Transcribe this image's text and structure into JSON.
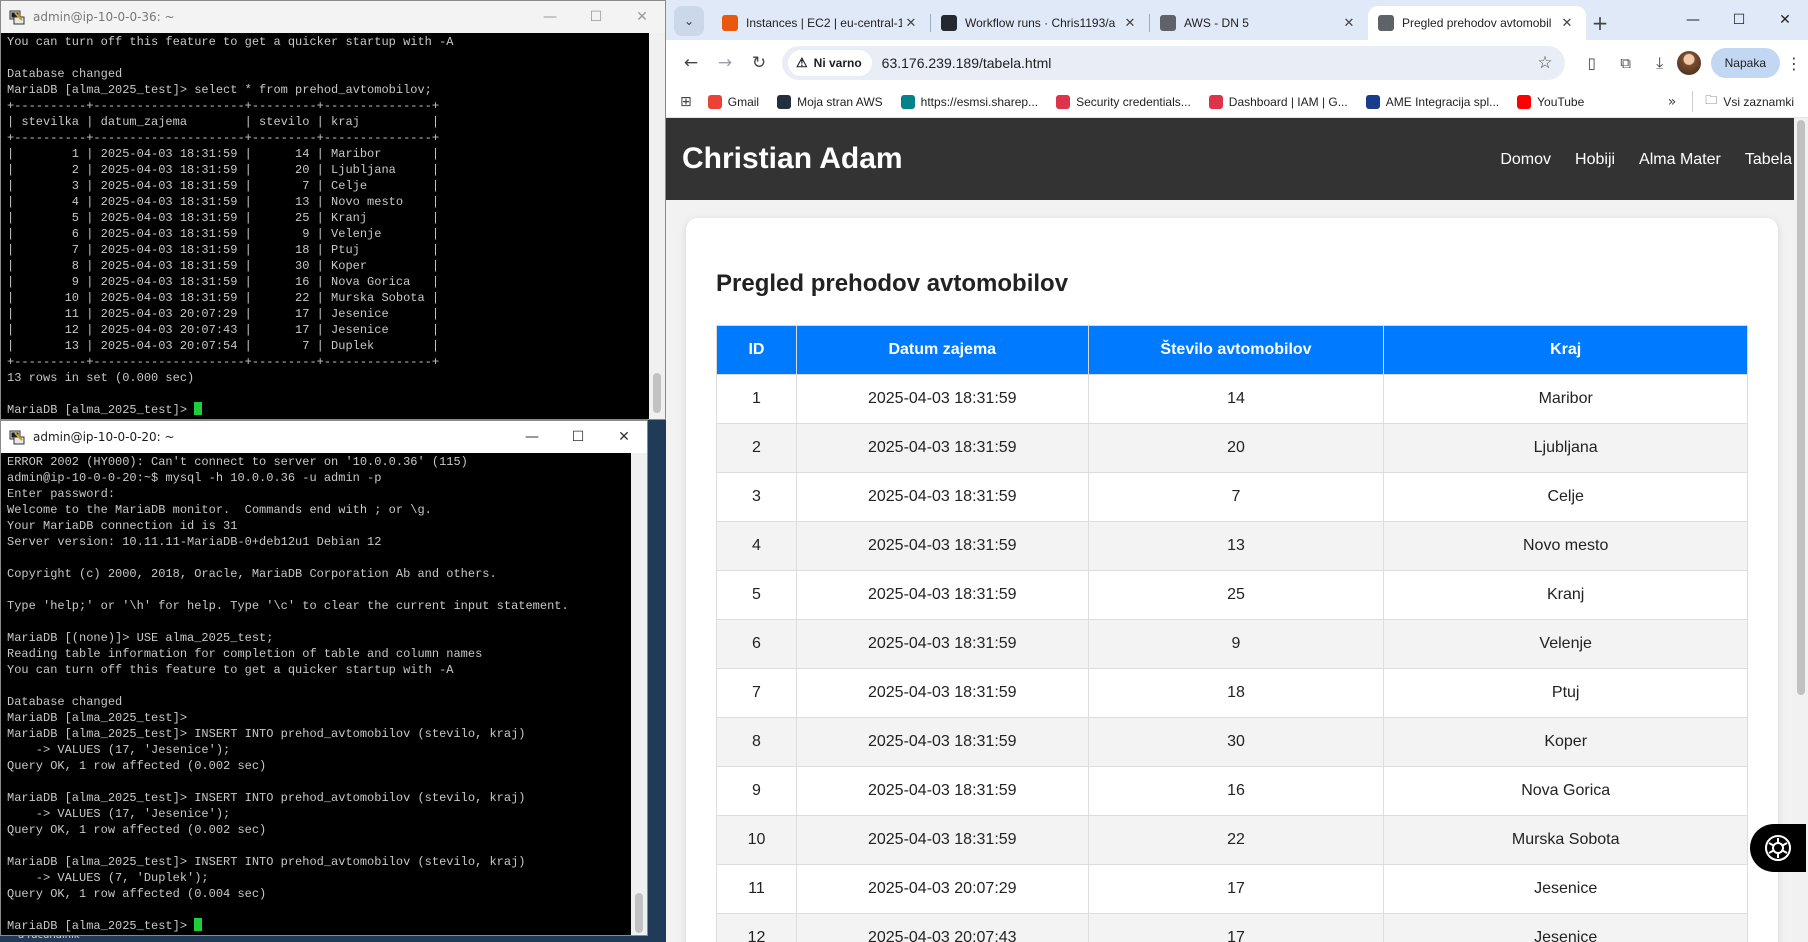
{
  "desktop": {
    "bottom_label": "a računalnik"
  },
  "putty_top": {
    "title": "admin@ip-10-0-0-36: ~",
    "lines": [
      "You can turn off this feature to get a quicker startup with -A",
      "",
      "Database changed",
      "MariaDB [alma_2025_test]> select * from prehod_avtomobilov;",
      "+----------+---------------------+---------+---------------+",
      "| stevilka | datum_zajema        | stevilo | kraj          |",
      "+----------+---------------------+---------+---------------+",
      "|        1 | 2025-04-03 18:31:59 |      14 | Maribor       |",
      "|        2 | 2025-04-03 18:31:59 |      20 | Ljubljana     |",
      "|        3 | 2025-04-03 18:31:59 |       7 | Celje         |",
      "|        4 | 2025-04-03 18:31:59 |      13 | Novo mesto    |",
      "|        5 | 2025-04-03 18:31:59 |      25 | Kranj         |",
      "|        6 | 2025-04-03 18:31:59 |       9 | Velenje       |",
      "|        7 | 2025-04-03 18:31:59 |      18 | Ptuj          |",
      "|        8 | 2025-04-03 18:31:59 |      30 | Koper         |",
      "|        9 | 2025-04-03 18:31:59 |      16 | Nova Gorica   |",
      "|       10 | 2025-04-03 18:31:59 |      22 | Murska Sobota |",
      "|       11 | 2025-04-03 20:07:29 |      17 | Jesenice      |",
      "|       12 | 2025-04-03 20:07:43 |      17 | Jesenice      |",
      "|       13 | 2025-04-03 20:07:54 |       7 | Duplek        |",
      "+----------+---------------------+---------+---------------+",
      "13 rows in set (0.000 sec)",
      ""
    ],
    "prompt": "MariaDB [alma_2025_test]> "
  },
  "putty_bottom": {
    "title": "admin@ip-10-0-0-20: ~",
    "lines": [
      "ERROR 2002 (HY000): Can't connect to server on '10.0.0.36' (115)",
      "admin@ip-10-0-0-20:~$ mysql -h 10.0.0.36 -u admin -p",
      "Enter password:",
      "Welcome to the MariaDB monitor.  Commands end with ; or \\g.",
      "Your MariaDB connection id is 31",
      "Server version: 10.11.11-MariaDB-0+deb12u1 Debian 12",
      "",
      "Copyright (c) 2000, 2018, Oracle, MariaDB Corporation Ab and others.",
      "",
      "Type 'help;' or '\\h' for help. Type '\\c' to clear the current input statement.",
      "",
      "MariaDB [(none)]> USE alma_2025_test;",
      "Reading table information for completion of table and column names",
      "You can turn off this feature to get a quicker startup with -A",
      "",
      "Database changed",
      "MariaDB [alma_2025_test]>",
      "MariaDB [alma_2025_test]> INSERT INTO prehod_avtomobilov (stevilo, kraj)",
      "    -> VALUES (17, 'Jesenice');",
      "Query OK, 1 row affected (0.002 sec)",
      "",
      "MariaDB [alma_2025_test]> INSERT INTO prehod_avtomobilov (stevilo, kraj)",
      "    -> VALUES (17, 'Jesenice');",
      "Query OK, 1 row affected (0.002 sec)",
      "",
      "MariaDB [alma_2025_test]> INSERT INTO prehod_avtomobilov (stevilo, kraj)",
      "    -> VALUES (7, 'Duplek');",
      "Query OK, 1 row affected (0.004 sec)",
      ""
    ],
    "prompt": "MariaDB [alma_2025_test]> "
  },
  "browser": {
    "tabs": [
      {
        "label": "Instances | EC2 | eu-central-1",
        "icon": "aws-ec2-icon",
        "color": "#e8590c"
      },
      {
        "label": "Workflow runs · Chris1193/a",
        "icon": "github-icon",
        "color": "#24292f"
      },
      {
        "label": "AWS - DN 5",
        "icon": "globe-icon",
        "color": "#5f6368"
      },
      {
        "label": "Pregled prehodov avtomobil",
        "icon": "globe-icon",
        "color": "#5f6368",
        "active": true
      }
    ],
    "security_label": "Ni varno",
    "url": "63.176.239.189/tabela.html",
    "profile_button": "Napaka",
    "bookmarks": [
      {
        "label": "Gmail",
        "icon": "gmail-icon",
        "color": "#ea4335"
      },
      {
        "label": "Moja stran AWS",
        "icon": "aws-icon",
        "color": "#232f3e"
      },
      {
        "label": "https://esmsi.sharep...",
        "icon": "sharepoint-icon",
        "color": "#038387"
      },
      {
        "label": "Security credentials...",
        "icon": "aws-iam-icon",
        "color": "#dd344c"
      },
      {
        "label": "Dashboard | IAM | G...",
        "icon": "aws-iam-icon",
        "color": "#dd344c"
      },
      {
        "label": "AME Integracija spl...",
        "icon": "ame-icon",
        "color": "#1a3c8c"
      },
      {
        "label": "YouTube",
        "icon": "youtube-icon",
        "color": "#ff0000"
      }
    ],
    "all_bookmarks": "Vsi zaznamki"
  },
  "page": {
    "site_title": "Christian Adam",
    "nav": [
      "Domov",
      "Hobiji",
      "Alma Mater",
      "Tabela"
    ],
    "heading": "Pregled prehodov avtomobilov",
    "header_color": "#007bff",
    "columns": [
      "ID",
      "Datum zajema",
      "Število avtomobilov",
      "Kraj"
    ],
    "rows": [
      [
        "1",
        "2025-04-03 18:31:59",
        "14",
        "Maribor"
      ],
      [
        "2",
        "2025-04-03 18:31:59",
        "20",
        "Ljubljana"
      ],
      [
        "3",
        "2025-04-03 18:31:59",
        "7",
        "Celje"
      ],
      [
        "4",
        "2025-04-03 18:31:59",
        "13",
        "Novo mesto"
      ],
      [
        "5",
        "2025-04-03 18:31:59",
        "25",
        "Kranj"
      ],
      [
        "6",
        "2025-04-03 18:31:59",
        "9",
        "Velenje"
      ],
      [
        "7",
        "2025-04-03 18:31:59",
        "18",
        "Ptuj"
      ],
      [
        "8",
        "2025-04-03 18:31:59",
        "30",
        "Koper"
      ],
      [
        "9",
        "2025-04-03 18:31:59",
        "16",
        "Nova Gorica"
      ],
      [
        "10",
        "2025-04-03 18:31:59",
        "22",
        "Murska Sobota"
      ],
      [
        "11",
        "2025-04-03 20:07:29",
        "17",
        "Jesenice"
      ],
      [
        "12",
        "2025-04-03 20:07:43",
        "17",
        "Jesenice"
      ]
    ]
  }
}
